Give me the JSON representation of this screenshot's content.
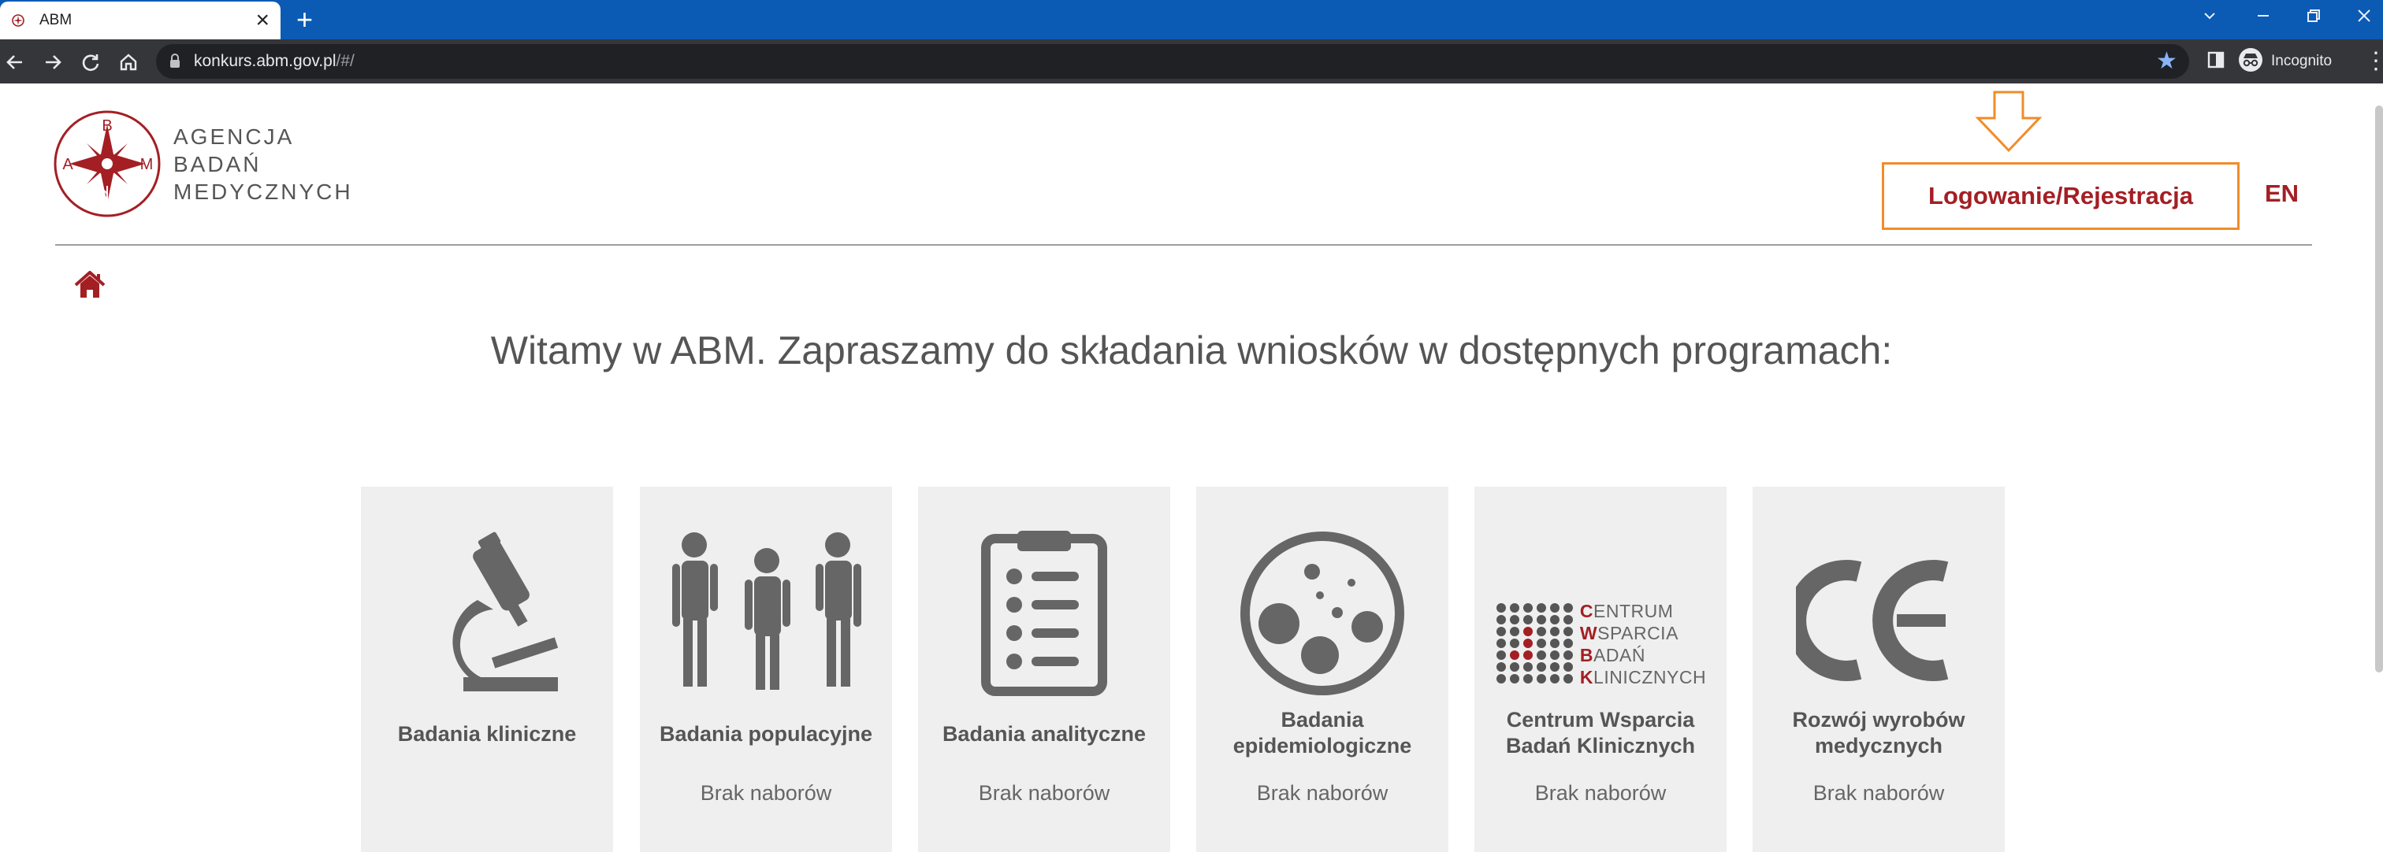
{
  "browser": {
    "tab_title": "ABM",
    "new_tab_symbol": "+",
    "url_domain": "konkurs.abm.gov.pl",
    "url_path": "/#/",
    "incognito_label": "Incognito",
    "icons": [
      "back-icon",
      "forward-icon",
      "reload-icon",
      "home-icon",
      "lock-icon",
      "star-icon",
      "side-panel-icon",
      "incognito-icon",
      "menu-icon"
    ]
  },
  "header": {
    "logo_letters": [
      "B",
      "A",
      "M"
    ],
    "logo_lines": [
      "AGENCJA",
      "BADAŃ",
      "MEDYCZNYCH"
    ],
    "login_label": "Logowanie/Rejestracja",
    "lang_label": "EN"
  },
  "main": {
    "welcome": "Witamy w ABM. Zapraszamy do składania wniosków w dostępnych programach:",
    "cards": [
      {
        "title": "Badania kliniczne",
        "status": "",
        "icon": "microscope-icon"
      },
      {
        "title": "Badania populacyjne",
        "status": "Brak naborów",
        "icon": "people-icon"
      },
      {
        "title": "Badania analityczne",
        "status": "Brak naborów",
        "icon": "clipboard-icon"
      },
      {
        "title": "Badania epidemiologiczne",
        "status": "Brak naborów",
        "icon": "petri-dish-icon"
      },
      {
        "title": "Centrum Wsparcia Badań Klinicznych",
        "status": "Brak naborów",
        "icon": "cwbk-logo",
        "logo_words": [
          {
            "initial": "C",
            "rest": "ENTRUM"
          },
          {
            "initial": "W",
            "rest": "SPARCIA"
          },
          {
            "initial": "B",
            "rest": "ADAŃ"
          },
          {
            "initial": "K",
            "rest": "LINICZNYCH"
          }
        ]
      },
      {
        "title": "Rozwój wyrobów medycznych",
        "status": "Brak naborów",
        "icon": "ce-mark-icon"
      }
    ]
  },
  "colors": {
    "brand_red": "#a31f24",
    "highlight_orange": "#f08c2a",
    "icon_gray": "#666666",
    "card_bg": "#efefef",
    "tabbar_blue": "#0b5ab4"
  }
}
